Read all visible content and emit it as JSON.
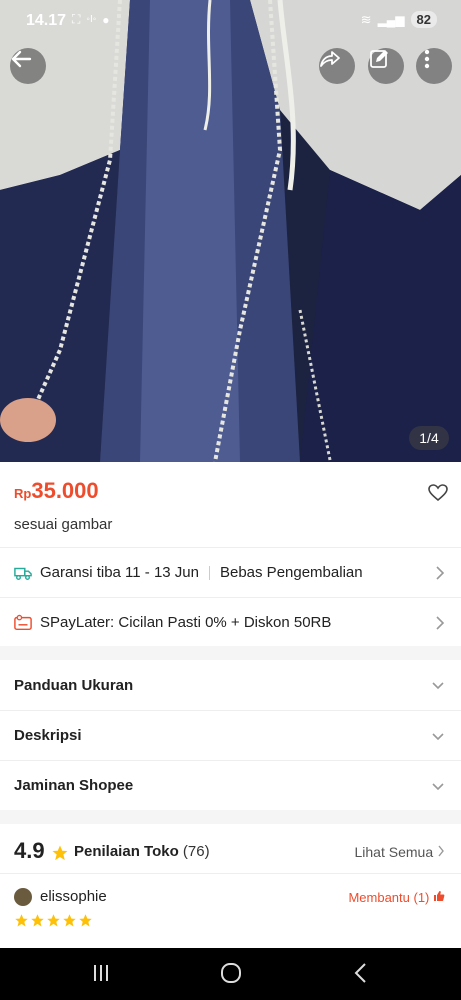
{
  "status_bar": {
    "time": "14.17",
    "battery": "82"
  },
  "gallery": {
    "counter": "1/4"
  },
  "product": {
    "currency": "Rp",
    "price": "35.000",
    "name": "sesuai gambar"
  },
  "shipping": {
    "guarantee": "Garansi tiba 11 - 13 Jun",
    "returns": "Bebas Pengembalian"
  },
  "paylater": {
    "text": "SPayLater: Cicilan Pasti 0% + Diskon 50RB"
  },
  "accordions": [
    {
      "title": "Panduan Ukuran"
    },
    {
      "title": "Deskripsi"
    },
    {
      "title": "Jaminan Shopee"
    }
  ],
  "ratings": {
    "score": "4.9",
    "label": "Penilaian Toko",
    "count": "(76)",
    "see_all": "Lihat Semua"
  },
  "review": {
    "username": "elissophie",
    "helpful": "Membantu (1)",
    "stars": 5
  },
  "colors": {
    "accent": "#ee4d2d",
    "star": "#ffc107",
    "shipping_icon": "#26aa99"
  }
}
